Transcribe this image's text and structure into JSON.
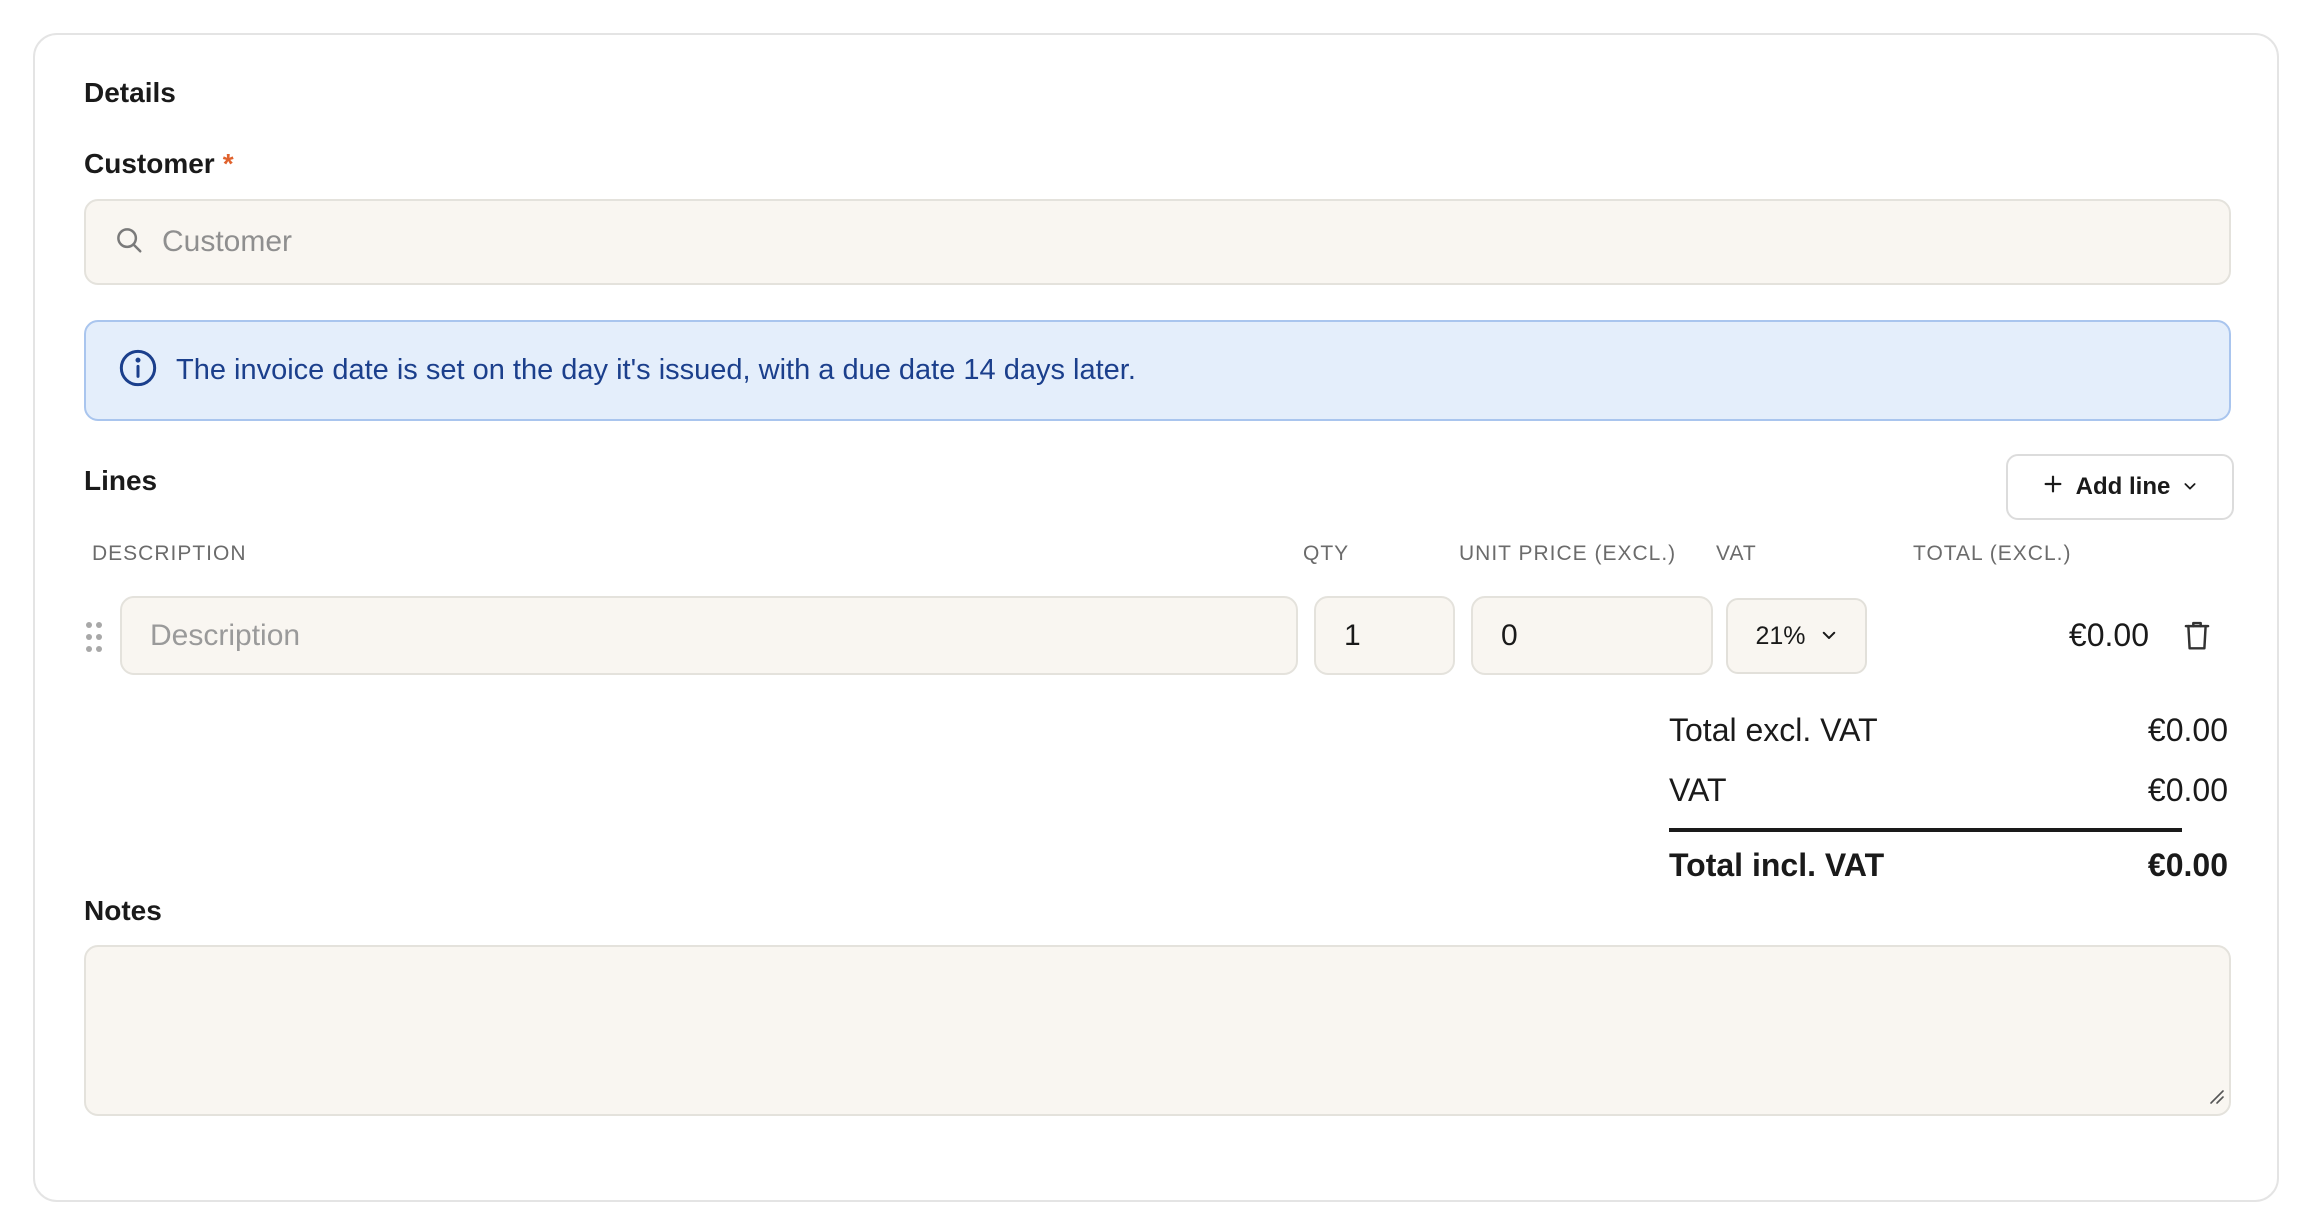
{
  "details": {
    "title": "Details",
    "customer_label": "Customer",
    "required_mark": "*",
    "customer_placeholder": "Customer"
  },
  "info": {
    "icon": "info-icon",
    "text": "The invoice date is set on the day it's issued, with a due date 14 days later."
  },
  "lines": {
    "title": "Lines",
    "add_line_label": "Add line",
    "headers": {
      "description": "DESCRIPTION",
      "qty": "QTY",
      "unit_price": "UNIT PRICE (EXCL.)",
      "vat": "VAT",
      "total": "TOTAL (EXCL.)"
    },
    "rows": [
      {
        "description_placeholder": "Description",
        "qty": "1",
        "unit_price": "0",
        "vat": "21%",
        "total": "€0.00"
      }
    ]
  },
  "summary": {
    "excl_label": "Total excl. VAT",
    "excl_value": "€0.00",
    "vat_label": "VAT",
    "vat_value": "€0.00",
    "incl_label": "Total incl. VAT",
    "incl_value": "€0.00"
  },
  "notes": {
    "label": "Notes",
    "value": ""
  },
  "colors": {
    "required": "#e0622d",
    "info_bg": "#e4eefb",
    "info_text": "#1b3f8c",
    "input_bg": "#f9f6f1"
  }
}
